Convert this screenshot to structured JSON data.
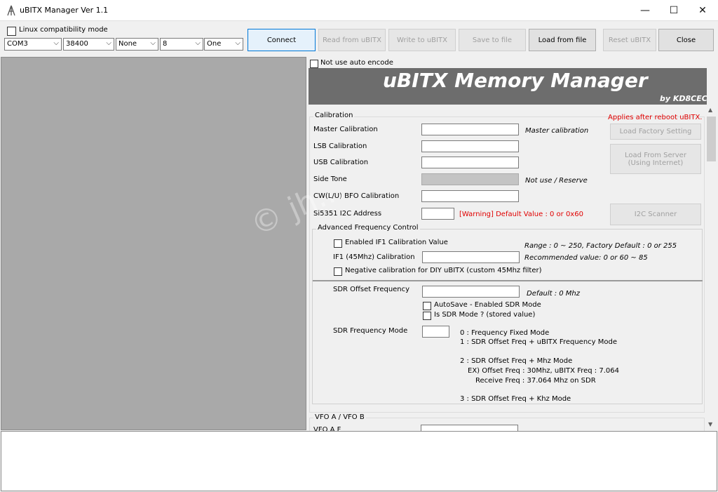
{
  "window": {
    "title": "uBITX Manager Ver 1.1",
    "minimize": "—",
    "maximize": "☐",
    "close": "✕"
  },
  "toolbar": {
    "linux_compat": "Linux compatibility mode",
    "port": "COM3",
    "baud": "38400",
    "parity": "None",
    "databits": "8",
    "stopbits": "One",
    "connect": "Connect",
    "read": "Read from uBITX",
    "write": "Write to uBITX",
    "save": "Save to file",
    "load": "Load from file",
    "reset": "Reset uBITX",
    "close": "Close"
  },
  "banner": {
    "not_use_encode": "Not use auto encode",
    "title": "uBITX Memory Manager",
    "by": "by KD8CEC"
  },
  "calibration": {
    "group": "Calibration",
    "applies_note": "Applies after reboot uBITX.",
    "master": "Master Calibration",
    "master_hint": "Master calibration",
    "lsb": "LSB Calibration",
    "usb": "USB Calibration",
    "side_tone": "Side Tone",
    "side_tone_hint": "Not use / Reserve",
    "cw_bfo": "CW(L/U) BFO Calibration",
    "si5351": "Si5351 I2C Address",
    "si5351_warning": "[Warning] Default Value : 0 or 0x60",
    "load_factory": "Load Factory Setting",
    "load_server": "Load From Server (Using Internet)",
    "i2c_scanner": "I2C Scanner"
  },
  "advanced": {
    "group": "Advanced Frequency Control",
    "if1_enable": "Enabled IF1 Calibration Value",
    "if1_range": "Range : 0 ~ 250, Factory Default : 0 or 255",
    "if1_label": "IF1 (45Mhz) Calibration",
    "if1_recommended": "Recommended value: 0 or 60 ~ 85",
    "negative_cal": "Negative calibration for DIY uBITX (custom 45Mhz filter)",
    "sdr_offset": "SDR Offset Frequency",
    "sdr_offset_default": "Default : 0 Mhz",
    "autosave": "AutoSave - Enabled SDR Mode",
    "is_sdr": "Is SDR Mode ? (stored value)",
    "sdr_mode": "SDR Frequency Mode",
    "mode_lines": [
      "0 : Frequency Fixed Mode",
      "1 : SDR Offset Freq + uBITX Frequency Mode",
      "2 : SDR Offset Freq + Mhz Mode",
      "EX) Offset Freq : 30Mhz, uBITX Freq : 7.064",
      "Receive Freq : 37.064 Mhz on SDR",
      "3 : SDR Offset Freq + Khz Mode"
    ]
  },
  "vfo": {
    "group": "VFO A / VFO B",
    "vfo_a": "VFO A F"
  },
  "watermark": "© jh..."
}
